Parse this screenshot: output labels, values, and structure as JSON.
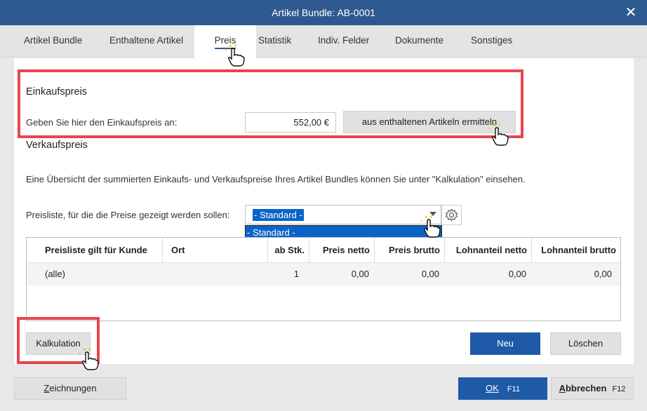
{
  "window": {
    "title": "Artikel Bundle: AB-0001",
    "close_label": "✕"
  },
  "tabs": [
    {
      "label": "Artikel Bundle"
    },
    {
      "label": "Enthaltene Artikel"
    },
    {
      "label": "Preis"
    },
    {
      "label": "Statistik"
    },
    {
      "label": "Indiv. Felder"
    },
    {
      "label": "Dokumente"
    },
    {
      "label": "Sonstiges"
    }
  ],
  "einkauf": {
    "title": "Einkaufspreis",
    "label": "Geben Sie hier den Einkaufspreis an:",
    "value": "552,00 €",
    "button": "aus enthaltenen Artikeln ermitteln"
  },
  "verkauf": {
    "title": "Verkaufspreis",
    "info": "Eine Übersicht der summierten Einkaufs- und Verkaufspreise Ihres Artikel Bundles können Sie unter \"Kalkulation\" einsehen.",
    "pricelist_label": "Preisliste, für die die Preise gezeigt werden sollen:",
    "pricelist_value": "- Standard -",
    "dropdown_option": "- Standard -"
  },
  "table": {
    "headers": [
      "Preisliste gilt für Kunde",
      "Ort",
      "ab Stk.",
      "Preis netto",
      "Preis brutto",
      "Lohnanteil netto",
      "Lohnanteil brutto"
    ],
    "rows": [
      [
        "(alle)",
        "",
        "1",
        "0,00",
        "0,00",
        "0,00",
        "0,00"
      ]
    ]
  },
  "actions": {
    "kalkulation": "Kalkulation",
    "neu": "Neu",
    "loeschen": "Löschen"
  },
  "footer": {
    "zeichnungen_pre": "Z",
    "zeichnungen_rest": "eichnungen",
    "ok_label": "OK",
    "ok_key": "F11",
    "abbrechen_pre": "A",
    "abbrechen_rest": "bbrechen",
    "abbrechen_key": "F12"
  },
  "colors": {
    "titlebar": "#2d5a8e",
    "primary": "#1f5aa8",
    "highlight": "#e8454f",
    "selection": "#0a64c8"
  },
  "icons": [
    "close-icon",
    "gear-icon",
    "dropdown-arrow-icon",
    "hand-cursor-icon"
  ]
}
